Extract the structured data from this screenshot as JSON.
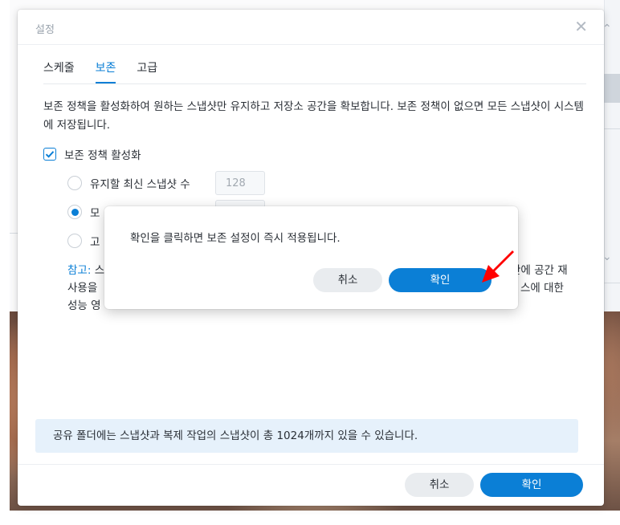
{
  "dialog": {
    "title": "설정",
    "close_icon": "close-icon",
    "tabs": [
      {
        "label": "스케줄",
        "active": false
      },
      {
        "label": "보존",
        "active": true
      },
      {
        "label": "고급",
        "active": false
      }
    ],
    "description": "보존 정책을 활성화하여 원하는 스냅샷만 유지하고 저장소 공간을 확보합니다. 보존 정책이 없으면 모든 스냅샷이 시스템에 저장됩니다.",
    "enable_policy": {
      "label": "보존 정책 활성화",
      "checked": true
    },
    "options": [
      {
        "label": "유지할 최신 스냅샷 수",
        "value": "128",
        "selected": false
      },
      {
        "label": "모",
        "value": "",
        "selected": true
      },
      {
        "label": "고",
        "value": "",
        "selected": false
      }
    ],
    "note": {
      "label": "참고:",
      "text_left_1": "스",
      "text_right_1": "간에 공간 재",
      "text_left_2": "사용을",
      "text_right_2": "스에 대한",
      "text_left_3": "성능 영"
    },
    "info": "공유 폴더에는 스냅샷과 복제 작업의 스냅샷이 총 1024개까지 있을 수 있습니다.",
    "cancel_label": "취소",
    "ok_label": "확인"
  },
  "popup": {
    "message": "확인을 클릭하면 보존 설정이 즉시 적용됩니다.",
    "cancel_label": "취소",
    "ok_label": "확인"
  },
  "colors": {
    "accent": "#0b7fd6",
    "info_bg": "#e6f1fb",
    "annotation_arrow": "#ff0000"
  }
}
